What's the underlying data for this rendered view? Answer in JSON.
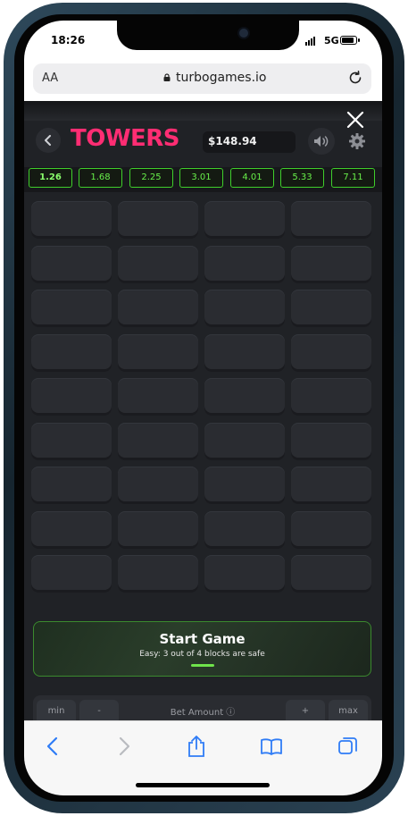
{
  "status_bar": {
    "time": "18:26",
    "network": "5G"
  },
  "browser": {
    "text_size_label": "AA",
    "url": "turbogames.io"
  },
  "game": {
    "title": "TOWERS",
    "balance": "$148.94",
    "multipliers": [
      "1.26",
      "1.68",
      "2.25",
      "3.01",
      "4.01",
      "5.33",
      "7.11"
    ],
    "grid": {
      "rows": 9,
      "columns": 4
    },
    "start_button": {
      "label": "Start Game",
      "subtitle": "Easy: 3 out of 4 blocks are safe"
    },
    "bet_panel": {
      "min_label": "min",
      "minus_label": "-",
      "bet_label": "Bet Amount ⓘ",
      "plus_label": "+",
      "max_label": "max"
    }
  },
  "colors": {
    "accent": "#ff2d73",
    "multiplier_green": "#68f04a",
    "browser_link_blue": "#2f7cf6"
  },
  "icons": [
    "back-chevron-icon",
    "close-icon",
    "sound-icon",
    "gear-icon",
    "lock-icon",
    "reload-icon",
    "share-icon",
    "bookmarks-icon",
    "tabs-icon"
  ]
}
